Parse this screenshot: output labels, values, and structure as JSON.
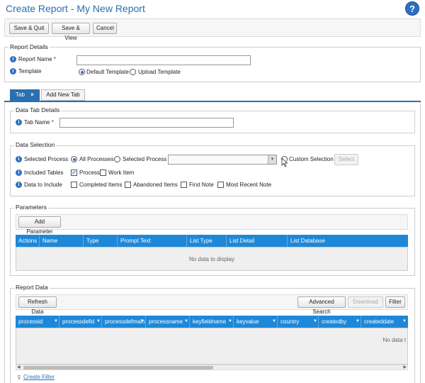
{
  "page": {
    "title": "Create Report - My New Report",
    "help": "?"
  },
  "toolbar": {
    "save_quit": "Save & Quit",
    "save_view": "Save & View",
    "cancel": "Cancel"
  },
  "report_details": {
    "legend": "Report Details",
    "name_label": "Report Name",
    "required": "*",
    "name_value": "",
    "template_label": "Template",
    "template_default": "Default Template",
    "template_upload": "Upload Template"
  },
  "tabs": {
    "active": "Tab",
    "close": "×",
    "add": "Add New Tab"
  },
  "data_tab": {
    "legend": "Data Tab Details",
    "name_label": "Tab Name",
    "required": "*",
    "name_value": ""
  },
  "data_selection": {
    "legend": "Data Selection",
    "selected_process_label": "Selected Process",
    "all_processes": "All Processes",
    "selected_process": "Selected Process",
    "custom_selection": "Custom Selection",
    "select_btn": "Select",
    "included_tables_label": "Included Tables",
    "process": "Process",
    "work_item": "Work Item",
    "data_to_include_label": "Data to Include",
    "completed": "Completed Items",
    "abandoned": "Abandoned Items",
    "first_note": "First Note",
    "recent_note": "Most Recent Note"
  },
  "parameters": {
    "legend": "Parameters",
    "add_btn": "Add Parameter",
    "columns": [
      "Actions",
      "Name",
      "Type",
      "Prompt Text",
      "List Type",
      "List Detail",
      "List Database"
    ],
    "empty": "No data to display"
  },
  "report_data": {
    "legend": "Report Data",
    "refresh": "Refresh Data",
    "advanced": "Advanced Search",
    "download": "Download",
    "filter": "Filter",
    "columns": [
      "processid",
      "processdefid",
      "processdefmainid",
      "processname",
      "keyfieldname",
      "keyvalue",
      "country",
      "createdby",
      "createddate"
    ],
    "empty": "No data t",
    "create_filter": "Create Filter"
  }
}
